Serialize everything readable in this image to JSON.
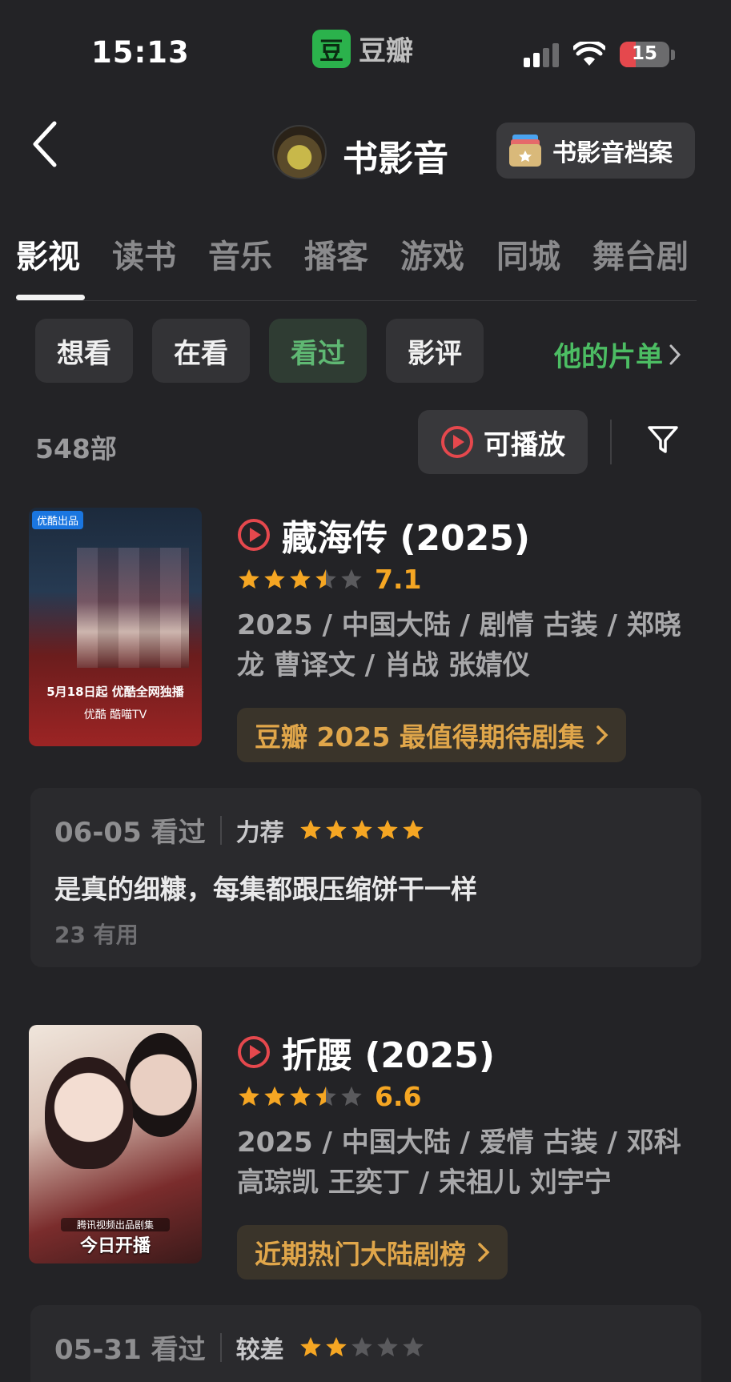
{
  "status": {
    "time": "15:13",
    "app_name": "豆瓣",
    "app_logo": "豆",
    "battery": "15"
  },
  "header": {
    "title": "书影音",
    "archive_label": "书影音档案"
  },
  "category_tabs": [
    "影视",
    "读书",
    "音乐",
    "播客",
    "游戏",
    "同城",
    "舞台剧"
  ],
  "sub_tabs": [
    "想看",
    "在看",
    "看过",
    "影评"
  ],
  "list_link": "他的片单",
  "count": "548部",
  "play_filter": "可播放",
  "items": [
    {
      "title": "藏海传 (2025)",
      "stars": 3.5,
      "score": "7.1",
      "meta": "2025 / 中国大陆 / 剧情 古装 / 郑晓龙 曹译文 / 肖战 张婧仪",
      "rank": "豆瓣 2025 最值得期待剧集",
      "poster": {
        "badge": "优酷出品",
        "date_line": "5月18日起 优酷全网独播",
        "platforms": "优酷  酷喵TV"
      },
      "review": {
        "date": "06-05 看过",
        "verdict": "力荐",
        "stars": 5,
        "text": "是真的细糠，每集都跟压缩饼干一样",
        "useful": "23 有用"
      }
    },
    {
      "title": "折腰 (2025)",
      "stars": 3.5,
      "score": "6.6",
      "meta": "2025 / 中国大陆 / 爱情 古装 / 邓科 高琮凯 王奕丁 / 宋祖儿 刘宇宁",
      "rank": "近期热门大陆剧榜",
      "poster": {
        "tag": "腾讯视频出品剧集",
        "today": "今日开播"
      },
      "review": {
        "date": "05-31 看过",
        "verdict": "较差",
        "stars": 2
      }
    }
  ],
  "colors": {
    "accent_green": "#4cbd63",
    "star": "#f5a623",
    "play_red": "#e5484d",
    "bg": "#232326"
  }
}
